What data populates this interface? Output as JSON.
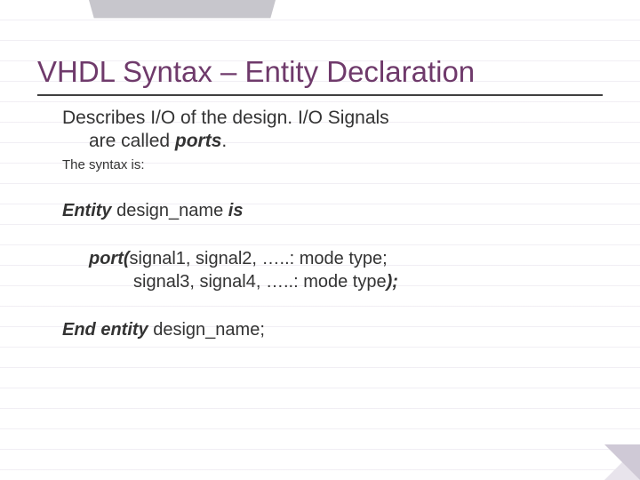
{
  "title": "VHDL Syntax – Entity Declaration",
  "desc_line1": "Describes I/O of the design.  I/O Signals",
  "desc_line2_pre": "are called ",
  "desc_line2_bold": "ports",
  "desc_line2_post": ".",
  "syntax_label": "The syntax is:",
  "entity_kw": "Entity",
  "entity_mid": " design_name ",
  "entity_is": "is",
  "port_kw": "port(",
  "port_line1_rest": "signal1, signal2, …..: mode type;",
  "port_line2_rest": "signal3, signal4, …..: mode type",
  "port_close": ");",
  "end_kw": "End entity",
  "end_rest": " design_name;"
}
